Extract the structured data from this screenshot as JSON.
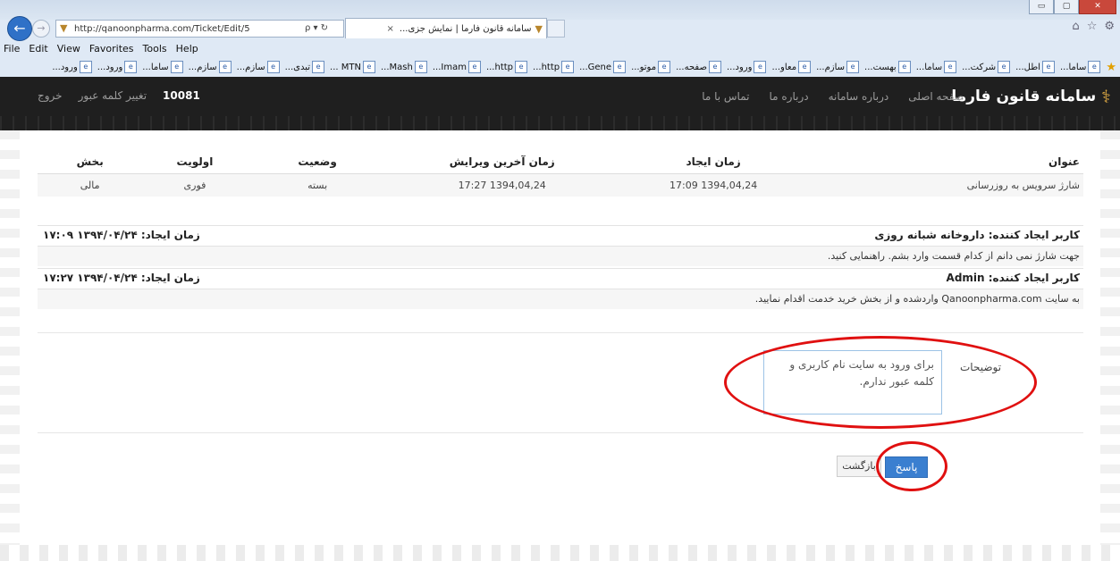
{
  "browser": {
    "window_controls": [
      "▭",
      "▢",
      "✕"
    ],
    "back_glyph": "←",
    "forward_glyph": "→",
    "address_url": "http://qanoonpharma.com/Ticket/Edit/5",
    "address_controls": "ρ ▾ ↻",
    "tab_title": "سامانه قانون فارما | نمایش جزی...",
    "tab_close": "×",
    "right_icons": [
      "⌂",
      "☆",
      "⚙"
    ],
    "menu": [
      "File",
      "Edit",
      "View",
      "Favorites",
      "Tools",
      "Help"
    ],
    "favorites": [
      "ساما...",
      "اطل...",
      "شرکت...",
      "ساما...",
      "بهست...",
      "سازم...",
      "معاو...",
      "ورود...",
      "صفحه...",
      "موتو...",
      "Gene...",
      "http...",
      "http...",
      "Imam...",
      "Mash...",
      "MTN ...",
      "تبدی...",
      "سازم...",
      "سازم...",
      "ساما...",
      "ورود...",
      "ورود..."
    ]
  },
  "site": {
    "brand": "سامانه قانون فارما",
    "nav": [
      "صفحه اصلی",
      "درباره سامانه",
      "درباره ما",
      "تماس با ما"
    ],
    "user_number": "10081",
    "change_password": "تغییر کلمه عبور",
    "logout": "خروج"
  },
  "ticket": {
    "headers": {
      "title": "عنوان",
      "created": "زمان ایجاد",
      "edited": "زمان آخرین ویرایش",
      "status": "وضعیت",
      "priority": "اولویت",
      "section": "بخش"
    },
    "row": {
      "title": "شارژ سرویس به روزرسانی",
      "created": "1394,04,24 17:09",
      "edited": "1394,04,24 17:27",
      "status": "بسته",
      "priority": "فوری",
      "section": "مالی"
    }
  },
  "messages": [
    {
      "author": "کاربر ایجاد کننده: داروخانه شبانه روزی",
      "created": "زمان ایجاد: ۱۳۹۴/۰۴/۲۴ ۱۷:۰۹",
      "body": "جهت شارژ نمی دانم از کدام قسمت وارد بشم. راهنمایی کنید."
    },
    {
      "author": "کاربر ایجاد کننده: Admin",
      "created": "زمان ایجاد: ۱۳۹۴/۰۴/۲۴ ۱۷:۲۷",
      "body": "به سایت Qanoonpharma.com واردشده و از بخش خرید خدمت اقدام نمایید."
    }
  ],
  "form": {
    "description_label": "توضیحات",
    "description_value": "برای ورود به سایت نام کاربری و کلمه عبور ندارم.",
    "back_button": "بازگشت",
    "reply_button": "پاسخ"
  },
  "colors": {
    "header_bg": "#1f1f1f",
    "accent_blue": "#3a7fd0",
    "annotation_red": "#e01010",
    "brand_gold": "#d8a543"
  }
}
